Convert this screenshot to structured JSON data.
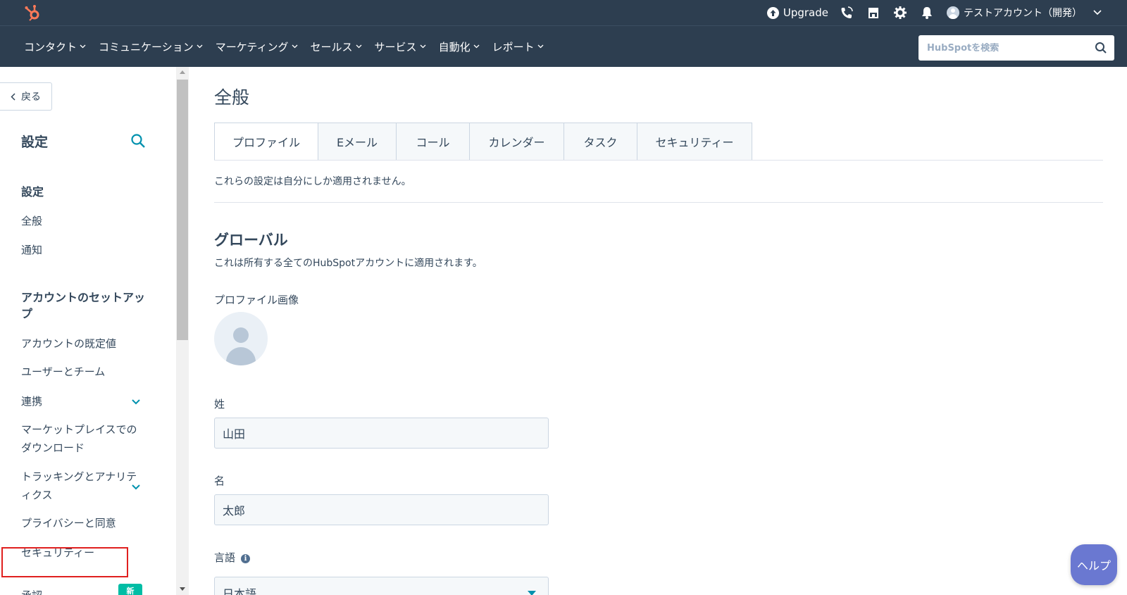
{
  "topbar": {
    "upgrade_label": "Upgrade",
    "account_name": "テストアカウント（開発）"
  },
  "nav": {
    "items": [
      "コンタクト",
      "コミュニケーション",
      "マーケティング",
      "セールス",
      "サービス",
      "自動化",
      "レポート"
    ],
    "search_placeholder": "HubSpotを検索"
  },
  "sidebar": {
    "back_label": "戻る",
    "title": "設定",
    "sections": [
      {
        "title": "設定",
        "items": [
          "全般",
          "通知"
        ]
      },
      {
        "title": "アカウントのセットアップ",
        "items": [
          "アカウントの既定値",
          "ユーザーとチーム",
          "連携",
          "マーケットプレイスでのダウンロード",
          "トラッキングとアナリティクス",
          "プライバシーと同意",
          "セキュリティー"
        ]
      }
    ],
    "new_badge": "新",
    "cut_item": "承認",
    "highlighted_item": "セキュリティー"
  },
  "main": {
    "title": "全般",
    "tabs": [
      "プロファイル",
      "Eメール",
      "コール",
      "カレンダー",
      "タスク",
      "セキュリティー"
    ],
    "active_tab": "プロファイル",
    "tab_description": "これらの設定は自分にしか適用されません。",
    "section_title": "グローバル",
    "section_description": "これは所有する全てのHubSpotアカウントに適用されます。",
    "profile_image_label": "プロファイル画像",
    "last_name_label": "姓",
    "last_name_value": "山田",
    "first_name_label": "名",
    "first_name_value": "太郎",
    "language_label": "言語",
    "language_value": "日本語"
  },
  "help_label": "ヘルプ",
  "colors": {
    "header_bg": "#2d3e50",
    "accent": "#0091ae",
    "logo": "#ff7a59",
    "highlight_border": "#e0201f",
    "help_bg": "#6a78d1",
    "badge": "#00bda5"
  }
}
